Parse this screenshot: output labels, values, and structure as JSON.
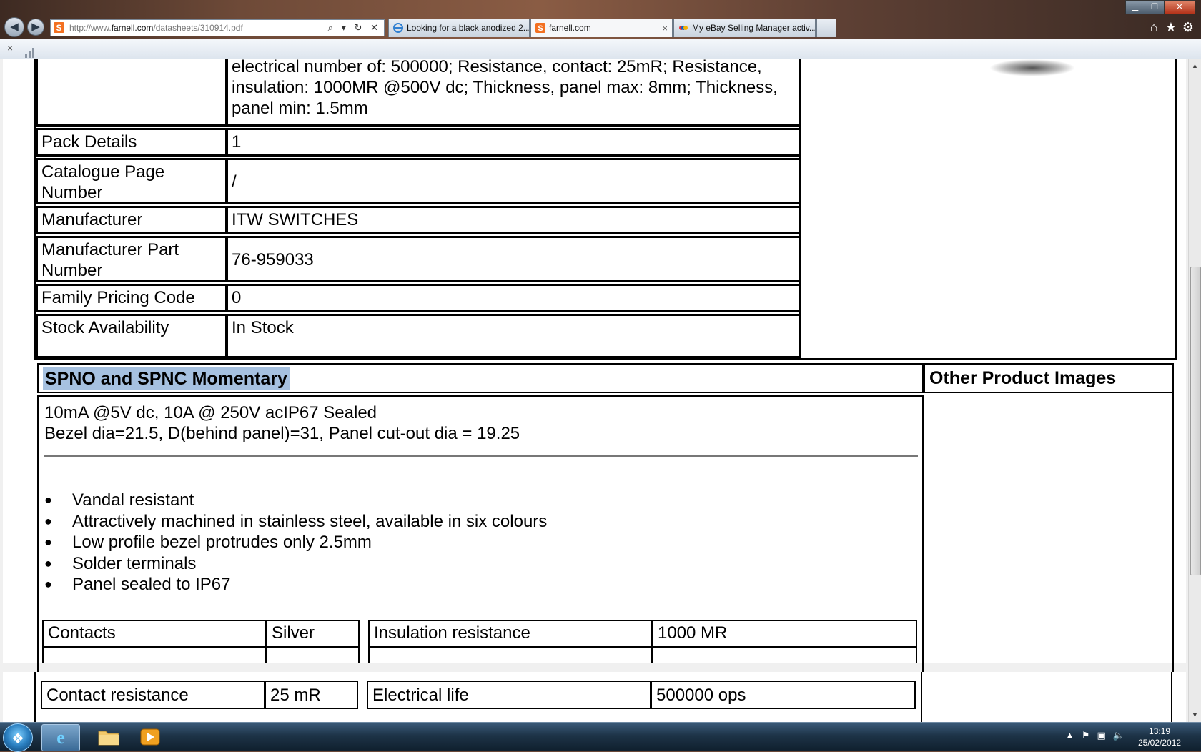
{
  "browser": {
    "url_prefix": "http://www.",
    "url_domain": "farnell.com",
    "url_path": "/datasheets/310914.pdf",
    "address_tools": "⌕ ▾ ↻ ✕",
    "back_icon": "back-arrow-icon",
    "forward_icon": "forward-arrow-icon",
    "tabs": [
      {
        "label": "Looking for a black anodized 2...",
        "icon": "ie-page-icon"
      },
      {
        "label": "farnell.com",
        "icon": "farnell-icon"
      },
      {
        "label": "My eBay Selling Manager activ...",
        "icon": "ebay-icon"
      }
    ],
    "tab_close": "×",
    "cmd_close": "×"
  },
  "spec_table": {
    "top_text": "electrical number of: 500000; Resistance, contact: 25mR; Resistance, insulation: 1000MR @500V dc; Thickness, panel max: 8mm; Thickness, panel min: 1.5mm",
    "rows": [
      {
        "label": "Pack Details",
        "value": "1"
      },
      {
        "label": "Catalogue Page Number",
        "value": "/"
      },
      {
        "label": "Manufacturer",
        "value": "ITW SWITCHES"
      },
      {
        "label": "Manufacturer Part Number",
        "value": "76-959033"
      },
      {
        "label": "Family Pricing Code",
        "value": "0"
      },
      {
        "label": "Stock Availability",
        "value": "In Stock"
      }
    ]
  },
  "product": {
    "title": "SPNO and SPNC Momentary",
    "other_images_heading": "Other Product Images",
    "desc_line1": "10mA @5V dc, 10A @ 250V acIP67 Sealed",
    "desc_line2": "Bezel dia=21.5, D(behind panel)=31, Panel cut-out dia = 19.25",
    "features": [
      "Vandal resistant",
      "Attractively machined in stainless steel, available in six colours",
      "Low profile bezel protrudes only 2.5mm",
      "Solder terminals",
      "Panel sealed to IP67"
    ],
    "props_row1": {
      "c1": "Contacts",
      "c2": "Silver",
      "c3": "Insulation resistance",
      "c4": "1000 MR"
    },
    "props_row2": {
      "c1": "Contact resistance",
      "c2": "25 mR",
      "c3": "Electrical life",
      "c4": "500000 ops"
    }
  },
  "taskbar": {
    "start_icon": "windows-start-icon",
    "clock_time": "13:19",
    "clock_date": "25/02/2012"
  },
  "colors": {
    "selection_highlight": "#a6c1e0",
    "taskbar": "#1d3347",
    "tab_active": "#f6f7f9"
  }
}
